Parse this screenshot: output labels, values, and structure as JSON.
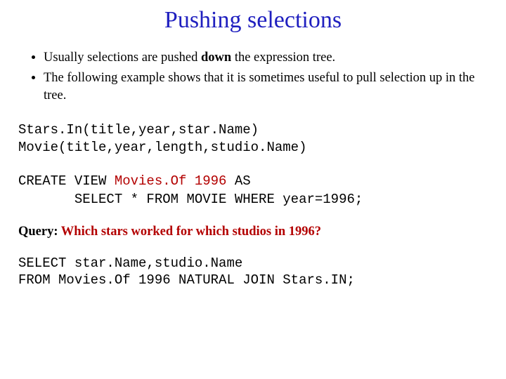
{
  "title": "Pushing selections",
  "bullets": {
    "b1_pre": "Usually selections are pushed ",
    "b1_bold": "down",
    "b1_post": " the  expression tree.",
    "b2": "The following example shows that it is sometimes useful to pull selection up in the tree."
  },
  "schema": "Stars.In(title,year,star.Name)\nMovie(title,year,length,studio.Name)",
  "view": {
    "line1_pre": "CREATE VIEW ",
    "line1_name": "Movies.Of 1996",
    "line1_post": " AS",
    "line2": "       SELECT * FROM MOVIE WHERE year=1996;"
  },
  "query_label": "Query:",
  "query_text": " Which stars worked for which studios in 1996?",
  "sql_final": "SELECT star.Name,studio.Name\nFROM Movies.Of 1996 NATURAL JOIN Stars.IN;"
}
